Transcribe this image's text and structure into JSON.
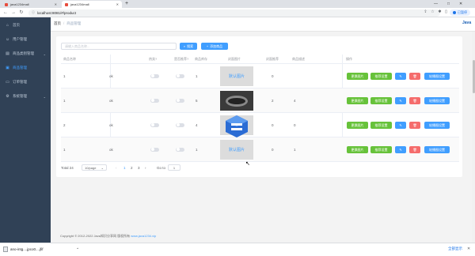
{
  "browser": {
    "tabs": [
      {
        "title": "java1234mall",
        "active": false
      },
      {
        "title": "java1234mall",
        "active": true
      }
    ],
    "new_tab": "+",
    "url": "localhost:8081/#/product",
    "update_label": "已暂停",
    "window_controls": [
      "—",
      "□",
      "✕"
    ]
  },
  "sidebar": {
    "items": [
      {
        "label": "首页",
        "icon": "home-icon",
        "arrow": ""
      },
      {
        "label": "用户管理",
        "icon": "user-icon",
        "arrow": ""
      },
      {
        "label": "商品类别管理",
        "icon": "category-icon",
        "arrow": "⌄"
      },
      {
        "label": "商品管理",
        "icon": "goods-icon",
        "arrow": ""
      },
      {
        "label": "订单管理",
        "icon": "order-icon",
        "arrow": ""
      },
      {
        "label": "系统管理",
        "icon": "settings-icon",
        "arrow": "⌄"
      }
    ],
    "active_index": 3,
    "bg": "#304156",
    "active_color": "#409eff"
  },
  "header": {
    "breadcrumb": [
      "首页",
      "商品管理"
    ],
    "logo": "Java"
  },
  "toolbar": {
    "search_placeholder": "请输入商品名称...",
    "search_button": "搜索",
    "add_button": "添加商品"
  },
  "table": {
    "columns": [
      "商品名称",
      "",
      "热卖?",
      "是否推荐?",
      "商品库存",
      "封面图片",
      "封面推荐",
      "商品描述",
      "操作"
    ],
    "rows": [
      {
        "name": "1",
        "price": "ok",
        "stock": "1",
        "image": "default",
        "rec_no": "0",
        "desc": ""
      },
      {
        "name": "1",
        "price": "ok",
        "stock": "5",
        "image": "photo",
        "rec_no": "2",
        "desc": "4"
      },
      {
        "name": "2",
        "price": "ok",
        "stock": "4",
        "image": "default",
        "rec_no": "0",
        "desc": "0"
      },
      {
        "name": "1",
        "price": "ok",
        "stock": "1",
        "image": "default",
        "rec_no": "0",
        "desc": "1"
      }
    ],
    "default_image_text": "默认图片",
    "actions": {
      "edit_image": "更换图片",
      "set_rec": "推荐设置",
      "edit": "✎",
      "delete": "🗑",
      "swiper": "轮播图设置"
    }
  },
  "pagination": {
    "total": "Total 24",
    "page_size": "10/page",
    "pages": [
      "1",
      "2",
      "3"
    ],
    "current_page": "1",
    "goto_label": "Go to",
    "goto_value": "1"
  },
  "footer": {
    "copyright": "Copyright © 2012-2022 Java知识分享网 版权所有",
    "link": "www.java1234.vip"
  },
  "download": {
    "filename": "ano-intg....jpco0....jfif",
    "show_all": "全部显示"
  }
}
